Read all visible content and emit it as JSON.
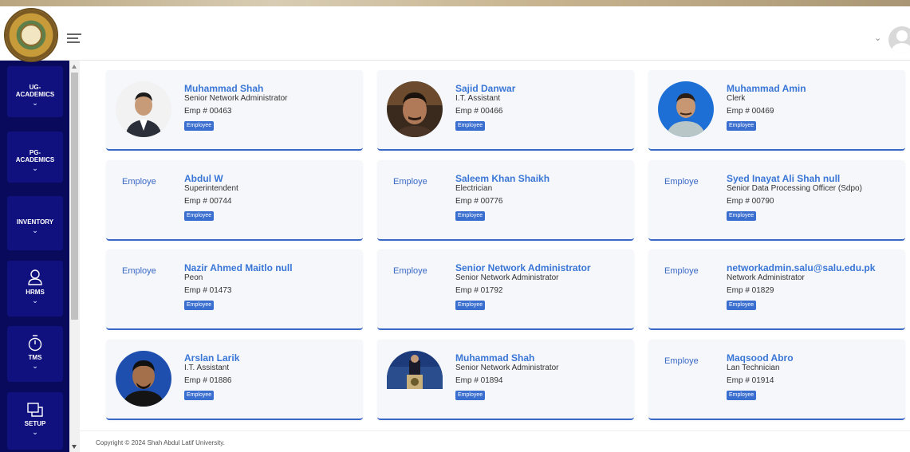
{
  "header": {
    "menu_icon": "hamburger-icon",
    "user_menu_icon": "chevron-down-icon",
    "avatar_icon": "user-avatar-icon"
  },
  "sidebar": {
    "items": [
      {
        "line1": "UG-",
        "line2": "ACADEMICS",
        "icon": ""
      },
      {
        "line1": "PG-",
        "line2": "ACADEMICS",
        "icon": ""
      },
      {
        "line1": "",
        "line2": "INVENTORY",
        "icon": ""
      },
      {
        "line1": "",
        "line2": "HRMS",
        "icon": "person-icon"
      },
      {
        "line1": "",
        "line2": "TMS",
        "icon": "stopwatch-icon"
      },
      {
        "line1": "",
        "line2": "SETUP",
        "icon": "windows-icon"
      }
    ],
    "chevron": "⌄"
  },
  "employees": [
    {
      "name": "Muhammad Shah",
      "designation": "Senior Network Administrator",
      "emp_no": "Emp # 00463",
      "badge": "Employee",
      "photo": "photo"
    },
    {
      "name": "Sajid Danwar",
      "designation": "I.T. Assistant",
      "emp_no": "Emp # 00466",
      "badge": "Employee",
      "photo": "photo"
    },
    {
      "name": "Muhammad Amin",
      "designation": "Clerk",
      "emp_no": "Emp # 00469",
      "badge": "Employee",
      "photo": "photo"
    },
    {
      "name": "Abdul W",
      "designation": "Superintendent",
      "emp_no": "Emp # 00744",
      "badge": "Employee",
      "photo_alt": "Employe"
    },
    {
      "name": "Saleem Khan Shaikh",
      "designation": "Electrician",
      "emp_no": "Emp # 00776",
      "badge": "Employee",
      "photo_alt": "Employe"
    },
    {
      "name": "Syed Inayat Ali Shah null",
      "designation": "Senior Data Processing Officer (Sdpo)",
      "emp_no": "Emp # 00790",
      "badge": "Employee",
      "photo_alt": "Employe"
    },
    {
      "name": "Nazir Ahmed Maitlo null",
      "designation": "Peon",
      "emp_no": "Emp # 01473",
      "badge": "Employee",
      "photo_alt": "Employe"
    },
    {
      "name": "Senior Network Administrator",
      "designation": "Senior Network Administrator",
      "emp_no": "Emp # 01792",
      "badge": "Employee",
      "photo_alt": "Employe"
    },
    {
      "name": "networkadmin.salu@salu.edu.pk",
      "designation": "Network Administrator",
      "emp_no": "Emp # 01829",
      "badge": "Employee",
      "photo_alt": "Employe"
    },
    {
      "name": "Arslan Larik",
      "designation": "I.T. Assistant",
      "emp_no": "Emp # 01886",
      "badge": "Employee",
      "photo": "photo"
    },
    {
      "name": "Muhammad Shah",
      "designation": "Senior Network Administrator",
      "emp_no": "Emp # 01894",
      "badge": "Employee",
      "photo": "photo"
    },
    {
      "name": "Maqsood Abro",
      "designation": "Lan Technician",
      "emp_no": "Emp # 01914",
      "badge": "Employee",
      "photo_alt": "Employe"
    }
  ],
  "footer": {
    "copyright": "Copyright © 2024 Shah Abdul Latif University."
  },
  "colors": {
    "sidebar_bg": "#0a0a5c",
    "sidebar_item": "#10107e",
    "accent": "#3a68c6",
    "name_text": "#3a76d6",
    "card_bg": "#f5f7fb"
  }
}
